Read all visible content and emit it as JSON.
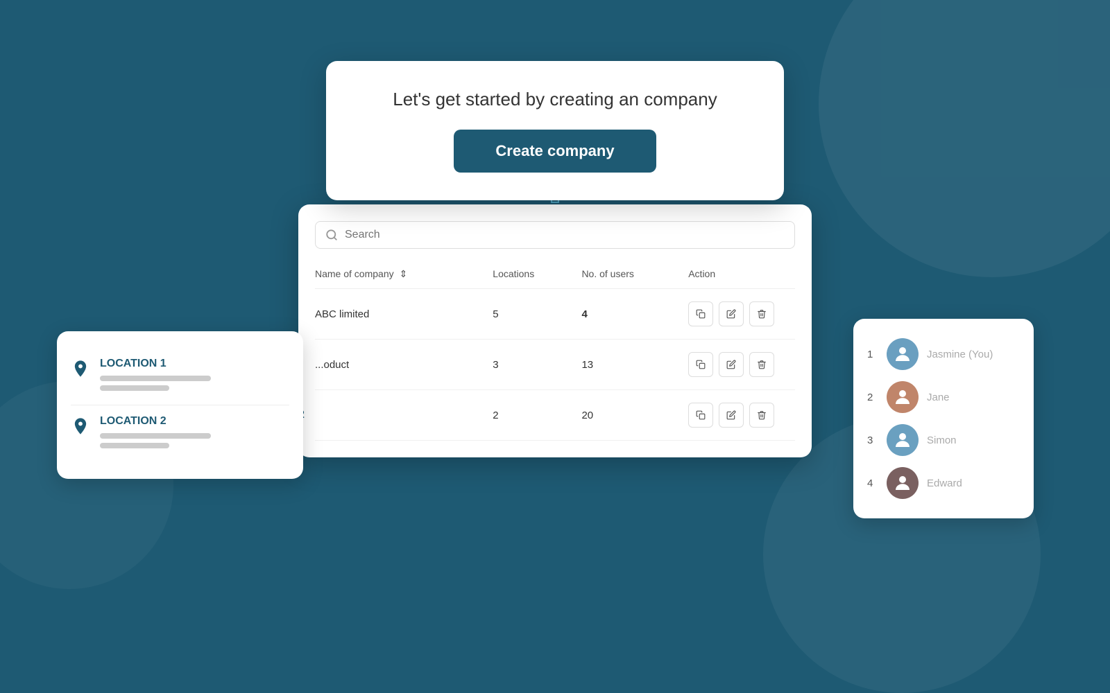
{
  "background": {
    "color": "#1e5a73"
  },
  "hero_card": {
    "subtitle": "Let's get started by creating an company",
    "button_label": "Create company"
  },
  "table": {
    "search_placeholder": "Search",
    "columns": [
      "Name of company",
      "Locations",
      "No. of users",
      "Action"
    ],
    "rows": [
      {
        "name": "ABC limited",
        "locations": "5",
        "users": "4"
      },
      {
        "name": "...oduct",
        "locations": "3",
        "users": "13"
      },
      {
        "name": "",
        "locations": "2",
        "users": "20"
      }
    ]
  },
  "location_card": {
    "items": [
      {
        "label": "LOCATION 1"
      },
      {
        "label": "LOCATION 2"
      }
    ]
  },
  "users_card": {
    "users": [
      {
        "num": "1",
        "name": "Jasmine (You)"
      },
      {
        "num": "2",
        "name": "Jane"
      },
      {
        "num": "3",
        "name": "Simon"
      },
      {
        "num": "4",
        "name": "Edward"
      }
    ]
  }
}
